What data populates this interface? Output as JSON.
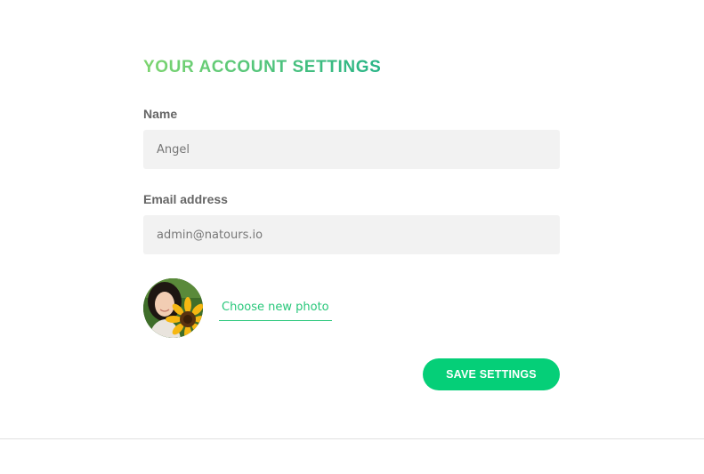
{
  "settings": {
    "heading": "Your account settings",
    "name_label": "Name",
    "name_value": "Angel",
    "email_label": "Email address",
    "email_value": "admin@natours.io",
    "photo_link": "Choose new photo",
    "save_button": "Save settings"
  },
  "colors": {
    "accent_green": "#05cf78",
    "heading_gradient_start": "#7dd56f",
    "heading_gradient_end": "#28b487",
    "input_bg": "#f2f2f2"
  },
  "icons": {
    "avatar": "user-photo-sunflower"
  }
}
